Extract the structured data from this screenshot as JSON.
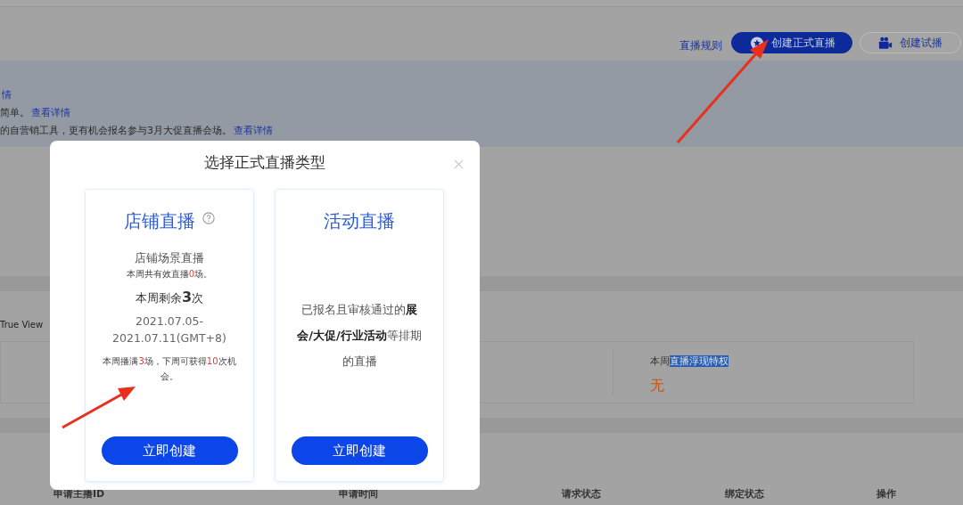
{
  "header": {
    "rules_link": "直播规则",
    "buttons": [
      {
        "label": "创建正式直播",
        "kind": "primary"
      },
      {
        "label": "创建试播",
        "kind": "secondary"
      }
    ]
  },
  "notice": {
    "lines": [
      {
        "link": "情"
      },
      {
        "text": "简单。",
        "link": "查看详情"
      },
      {
        "text": "的自营销工具，更有机会报名参与3月大促直播会场。",
        "link": "查看详情"
      }
    ]
  },
  "section": {
    "label": "True View"
  },
  "stats_card": {
    "label": "本周",
    "selected_text": "直播浮现特权",
    "value": "无"
  },
  "table": {
    "columns": [
      "申请主播ID",
      "申请时间",
      "请求状态",
      "绑定状态",
      "操作"
    ]
  },
  "dialog": {
    "title": "选择正式直播类型",
    "cards": [
      {
        "title": "店铺直播",
        "help_icon": true,
        "subtitle": "店铺场景直播",
        "note": [
          {
            "text": "本周共有效直播",
            "red": false
          },
          {
            "text": "0",
            "red": true
          },
          {
            "text": "场。",
            "red": false
          }
        ],
        "remaining": "本周剩余**3**次",
        "period": "2021.07.05-2021.07.11(GMT+8)",
        "hint": [
          {
            "text": "本周播满",
            "red": false
          },
          {
            "text": "3",
            "red": true
          },
          {
            "text": "场，下周可获得",
            "red": false
          },
          {
            "text": "10",
            "red": true
          },
          {
            "text": "次机会。",
            "red": false
          }
        ],
        "button": "立即创建"
      },
      {
        "title": "活动直播",
        "help_icon": false,
        "description": "已报名且审核通过的**展会/大促/行业活动**等排期的直播",
        "button": "立即创建"
      }
    ]
  }
}
